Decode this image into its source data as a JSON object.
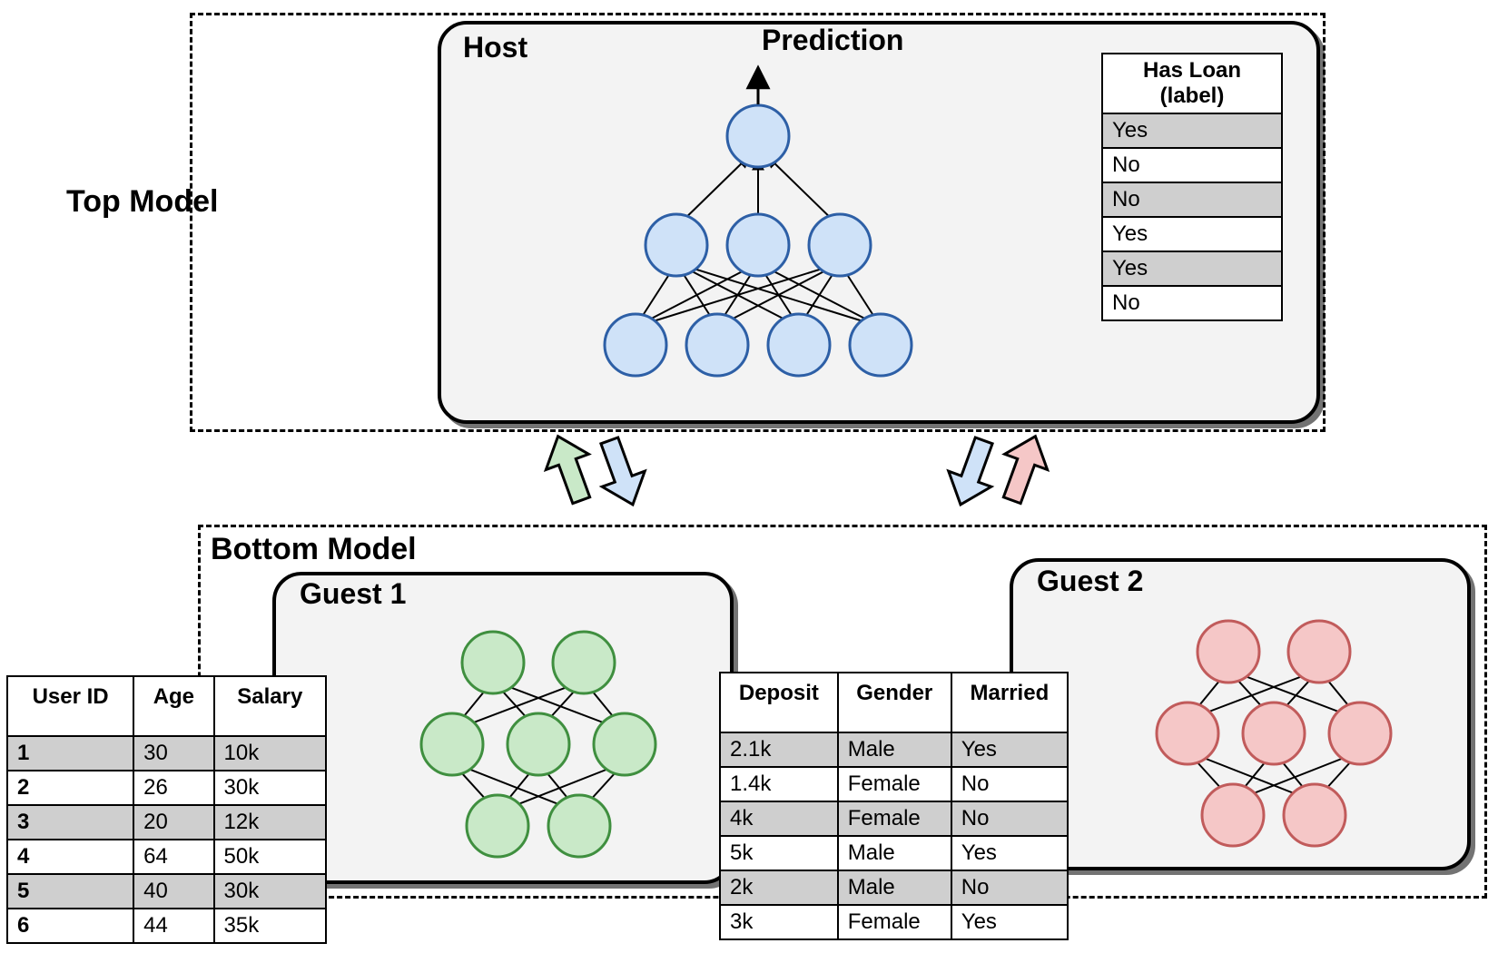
{
  "top_model_label": "Top Model",
  "bottom_model_label": "Bottom Model",
  "host": {
    "title": "Host",
    "prediction_label": "Prediction",
    "label_table": {
      "header": "Has Loan (label)",
      "rows": [
        "Yes",
        "No",
        "No",
        "Yes",
        "Yes",
        "No"
      ]
    }
  },
  "guest1": {
    "title": "Guest 1",
    "table": {
      "headers": [
        "User ID",
        "Age",
        "Salary"
      ],
      "rows": [
        [
          "1",
          "30",
          "10k"
        ],
        [
          "2",
          "26",
          "30k"
        ],
        [
          "3",
          "20",
          "12k"
        ],
        [
          "4",
          "64",
          "50k"
        ],
        [
          "5",
          "40",
          "30k"
        ],
        [
          "6",
          "44",
          "35k"
        ]
      ]
    }
  },
  "guest2": {
    "title": "Guest 2",
    "table": {
      "headers": [
        "Deposit",
        "Gender",
        "Married"
      ],
      "rows": [
        [
          "2.1k",
          "Male",
          "Yes"
        ],
        [
          "1.4k",
          "Female",
          "No"
        ],
        [
          "4k",
          "Female",
          "No"
        ],
        [
          "5k",
          "Male",
          "Yes"
        ],
        [
          "2k",
          "Male",
          "No"
        ],
        [
          "3k",
          "Female",
          "Yes"
        ]
      ]
    }
  },
  "colors": {
    "blue": "#cfe2f8",
    "green": "#c9e9c8",
    "red": "#f5c7c7"
  }
}
